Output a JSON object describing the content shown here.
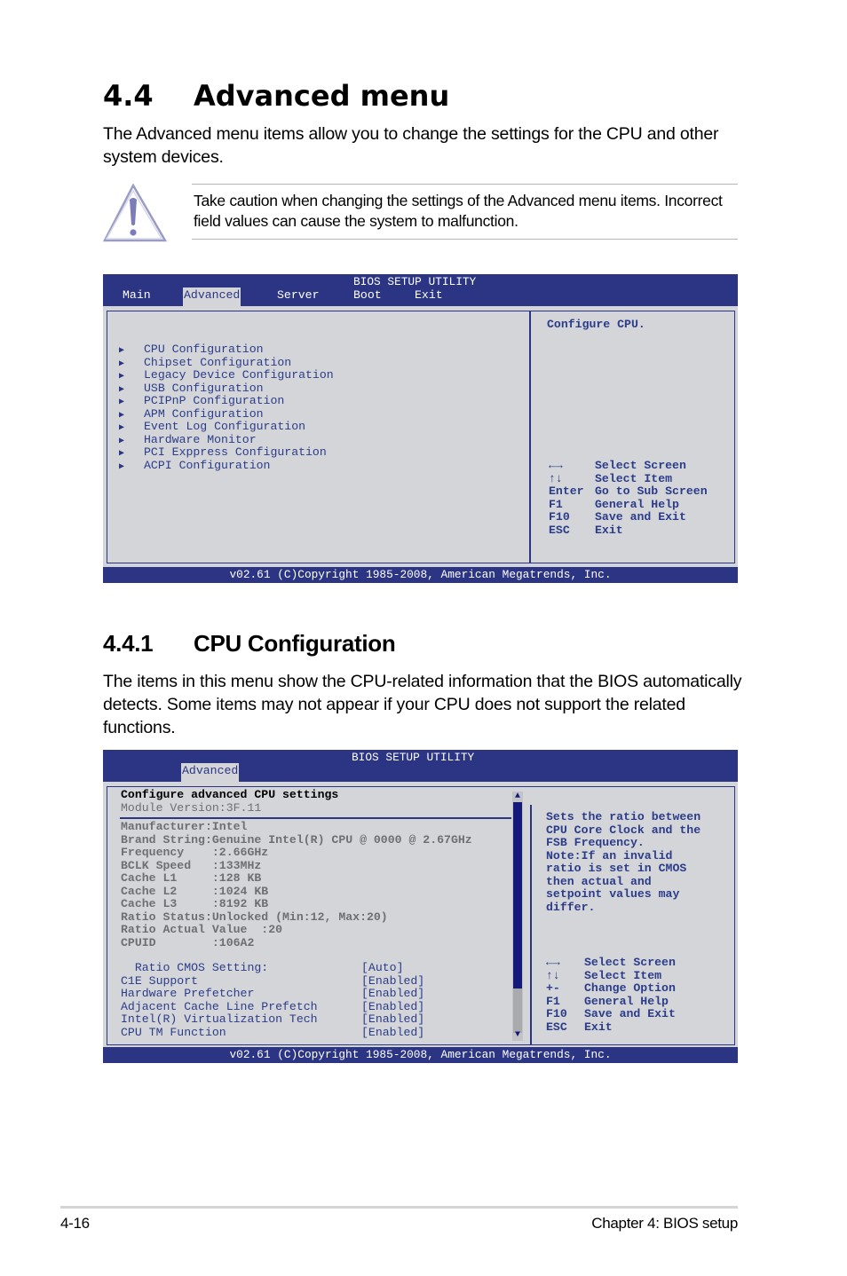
{
  "section": {
    "number": "4.4",
    "title": "Advanced menu",
    "intro": "The Advanced menu items allow you to change the settings for the CPU and other system devices."
  },
  "caution": {
    "icon": "warning-triangle-icon",
    "text": "Take caution when changing the settings of the Advanced menu items. Incorrect field values can cause the system to malfunction."
  },
  "bios_advanced": {
    "title": "BIOS SETUP UTILITY",
    "tabs": [
      {
        "label": "Main",
        "active": false
      },
      {
        "label": "Advanced",
        "active": true
      },
      {
        "label": "Server",
        "active": false
      },
      {
        "label": "Boot",
        "active": false
      },
      {
        "label": "Exit",
        "active": false
      }
    ],
    "menu_items": [
      "CPU Configuration",
      "Chipset Configuration",
      "Legacy Device Configuration",
      "USB Configuration",
      "PCIPnP Configuration",
      "APM Configuration",
      "Event Log Configuration",
      "Hardware Monitor",
      "PCI Exppress Configuration",
      "ACPI Configuration"
    ],
    "menu_arrow": "▶",
    "help_text": "Configure CPU.",
    "keys": [
      {
        "key": "←→",
        "action": "Select Screen"
      },
      {
        "key": "↑↓",
        "action": "Select Item"
      },
      {
        "key": "Enter",
        "action": "Go to Sub Screen"
      },
      {
        "key": "F1",
        "action": "General Help"
      },
      {
        "key": "F10",
        "action": "Save and Exit"
      },
      {
        "key": "ESC",
        "action": "Exit"
      }
    ],
    "footer": "v02.61 (C)Copyright 1985-2008, American Megatrends, Inc.",
    "colors": {
      "bar": "#2b3584",
      "panel": "#d4d5d8",
      "text": "#2b3c8a"
    }
  },
  "subsection": {
    "number": "4.4.1",
    "title": "CPU Configuration",
    "intro": "The items in this menu show the CPU-related information that the BIOS automatically detects. Some items may not appear if your CPU does not support the related functions."
  },
  "bios_cpu": {
    "title": "BIOS SETUP UTILITY",
    "active_tab": "Advanced",
    "heading": "Configure advanced CPU settings",
    "module_version": "Module Version:3F.11",
    "info_lines": [
      "Manufacturer:Intel",
      "Brand String:Genuine Intel(R) CPU @ 0000 @ 2.67GHz",
      "Frequency    :2.66GHz",
      "BCLK Speed   :133MHz",
      "Cache L1     :128 KB",
      "Cache L2     :1024 KB",
      "Cache L3     :8192 KB",
      "Ratio Status:Unlocked (Min:12, Max:20)",
      "Ratio Actual Value  :20",
      "CPUID        :106A2"
    ],
    "settings": [
      {
        "label": "  Ratio CMOS Setting:",
        "value": "[Auto]"
      },
      {
        "label": "C1E Support",
        "value": "[Enabled]"
      },
      {
        "label": "Hardware Prefetcher",
        "value": "[Enabled]"
      },
      {
        "label": "Adjacent Cache Line Prefetch",
        "value": "[Enabled]"
      },
      {
        "label": "Intel(R) Virtualization Tech",
        "value": "[Enabled]"
      },
      {
        "label": "CPU TM Function",
        "value": "[Enabled]"
      }
    ],
    "help_lines": [
      "Sets the ratio between",
      "CPU Core Clock and the",
      "FSB Frequency.",
      "Note:If an invalid",
      "ratio is set in CMOS",
      "then actual and",
      "setpoint values may",
      "differ."
    ],
    "keys": [
      {
        "key": "←→",
        "action": "Select Screen"
      },
      {
        "key": "↑↓",
        "action": "Select Item"
      },
      {
        "key": "+-",
        "action": "Change Option"
      },
      {
        "key": "F1",
        "action": "General Help"
      },
      {
        "key": "F10",
        "action": "Save and Exit"
      },
      {
        "key": "ESC",
        "action": "Exit"
      }
    ],
    "scrollbar": {
      "up": "▲",
      "down": "▼",
      "position_fraction": 0.0,
      "visible_fraction": 0.8
    },
    "footer": "v02.61 (C)Copyright 1985-2008, American Megatrends, Inc."
  },
  "page_footer": {
    "page_number": "4-16",
    "chapter": "Chapter 4: BIOS setup"
  }
}
